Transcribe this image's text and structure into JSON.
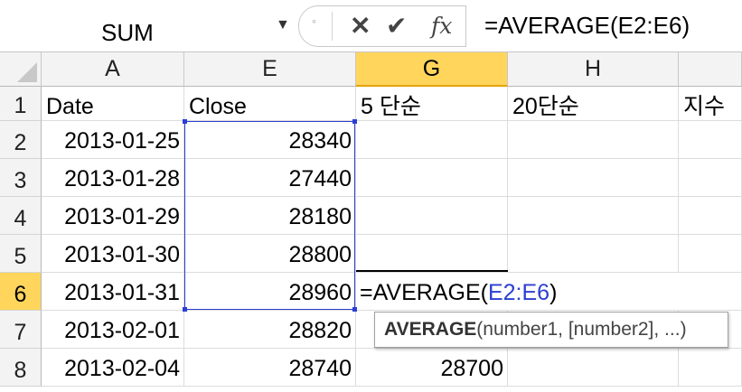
{
  "formula_bar": {
    "name_box": "SUM",
    "name_box_arrow": "▼",
    "cancel_icon": "✕",
    "enter_icon": "✔",
    "fx_label": "fx",
    "formula": "=AVERAGE(E2:E6)"
  },
  "columns": [
    "A",
    "E",
    "G",
    "H",
    ""
  ],
  "rows": [
    "1",
    "2",
    "3",
    "4",
    "5",
    "6",
    "7",
    "8"
  ],
  "headers": {
    "date": "Date",
    "close": "Close",
    "g": "5 단순",
    "h": "20단순",
    "i": "지수"
  },
  "data_rows": [
    {
      "date": "2013-01-25",
      "close": "28340"
    },
    {
      "date": "2013-01-28",
      "close": "27440"
    },
    {
      "date": "2013-01-29",
      "close": "28180"
    },
    {
      "date": "2013-01-30",
      "close": "28800"
    },
    {
      "date": "2013-01-31",
      "close": "28960"
    },
    {
      "date": "2013-02-01",
      "close": "28820"
    },
    {
      "date": "2013-02-04",
      "close": "28740",
      "g": "28700"
    }
  ],
  "editing_cell": {
    "prefix": "=AVERAGE(",
    "ref": "E2:E6",
    "suffix": ")"
  },
  "tooltip": {
    "func": "AVERAGE",
    "args": "(number1, [number2], ...)"
  },
  "colors": {
    "selected_header": "#ffd55c",
    "reference_blue": "#2b3fd2"
  }
}
